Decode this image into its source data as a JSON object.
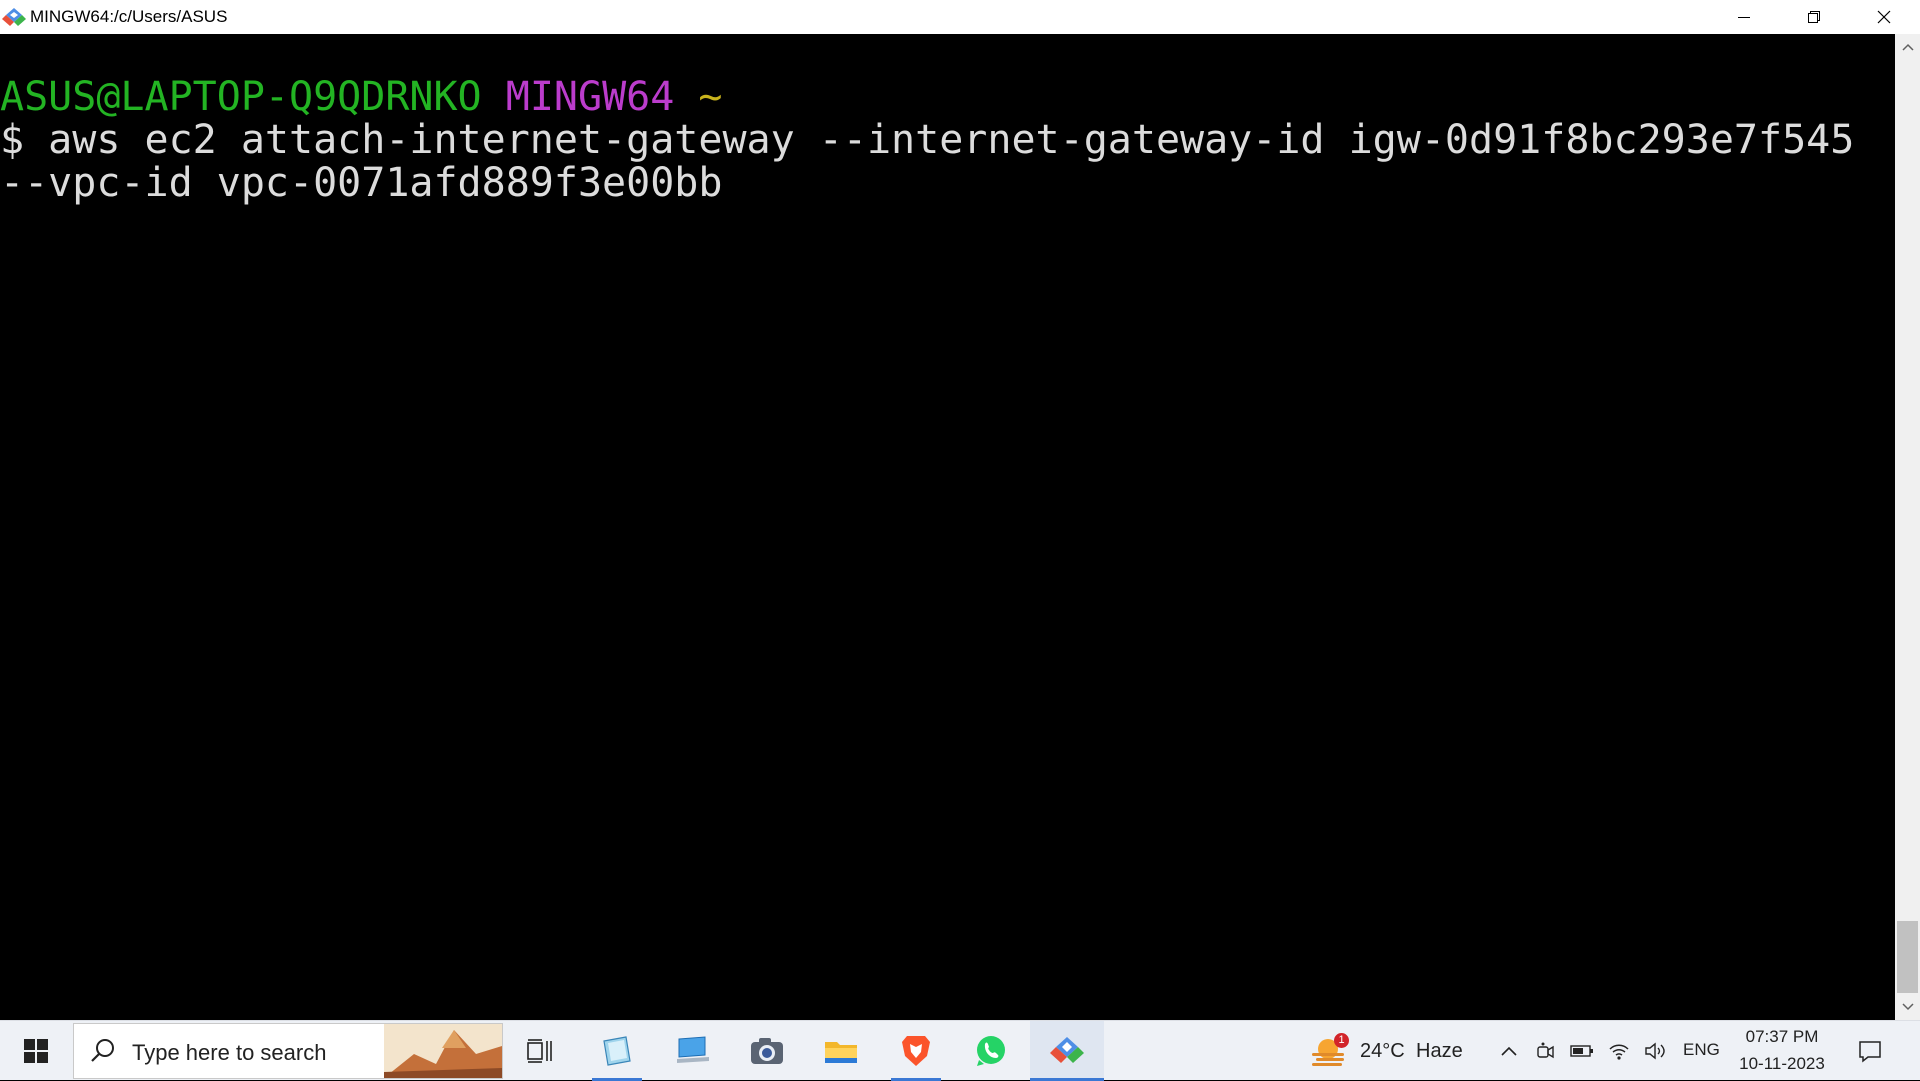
{
  "window": {
    "title": "MINGW64:/c/Users/ASUS",
    "app_icon": "git-bash-icon",
    "controls": [
      "minimize-icon",
      "maximize-icon",
      "close-icon"
    ]
  },
  "terminal": {
    "prompt_user": "ASUS@LAPTOP-Q9QDRNKO",
    "prompt_env": "MINGW64",
    "prompt_cwd": "~",
    "command_line_1": "$ aws ec2 attach-internet-gateway --internet-gateway-id igw-0d91f8bc293e7f545",
    "command_line_2": "--vpc-id vpc-0071afd889f3e00bb",
    "colors": {
      "user": "#23b423",
      "env": "#bb3ccc",
      "cwd": "#c8b31c",
      "text": "#dcdcdc",
      "background": "#000000"
    }
  },
  "taskbar": {
    "search_placeholder": "Type here to search",
    "apps": [
      "start-icon",
      "task-view-icon",
      "notepad-icon",
      "computer-icon",
      "camera-icon",
      "file-explorer-icon",
      "brave-icon",
      "whatsapp-icon",
      "git-bash-icon"
    ],
    "weather": {
      "badge": "1",
      "temperature": "24°C",
      "condition": "Haze"
    },
    "tray_icons": [
      "chevron-up-icon",
      "meet-icon",
      "battery-icon",
      "wifi-icon",
      "volume-icon"
    ],
    "language": "ENG",
    "time": "07:37 PM",
    "date": "10-11-2023",
    "accent_color": "#3a78d4"
  }
}
